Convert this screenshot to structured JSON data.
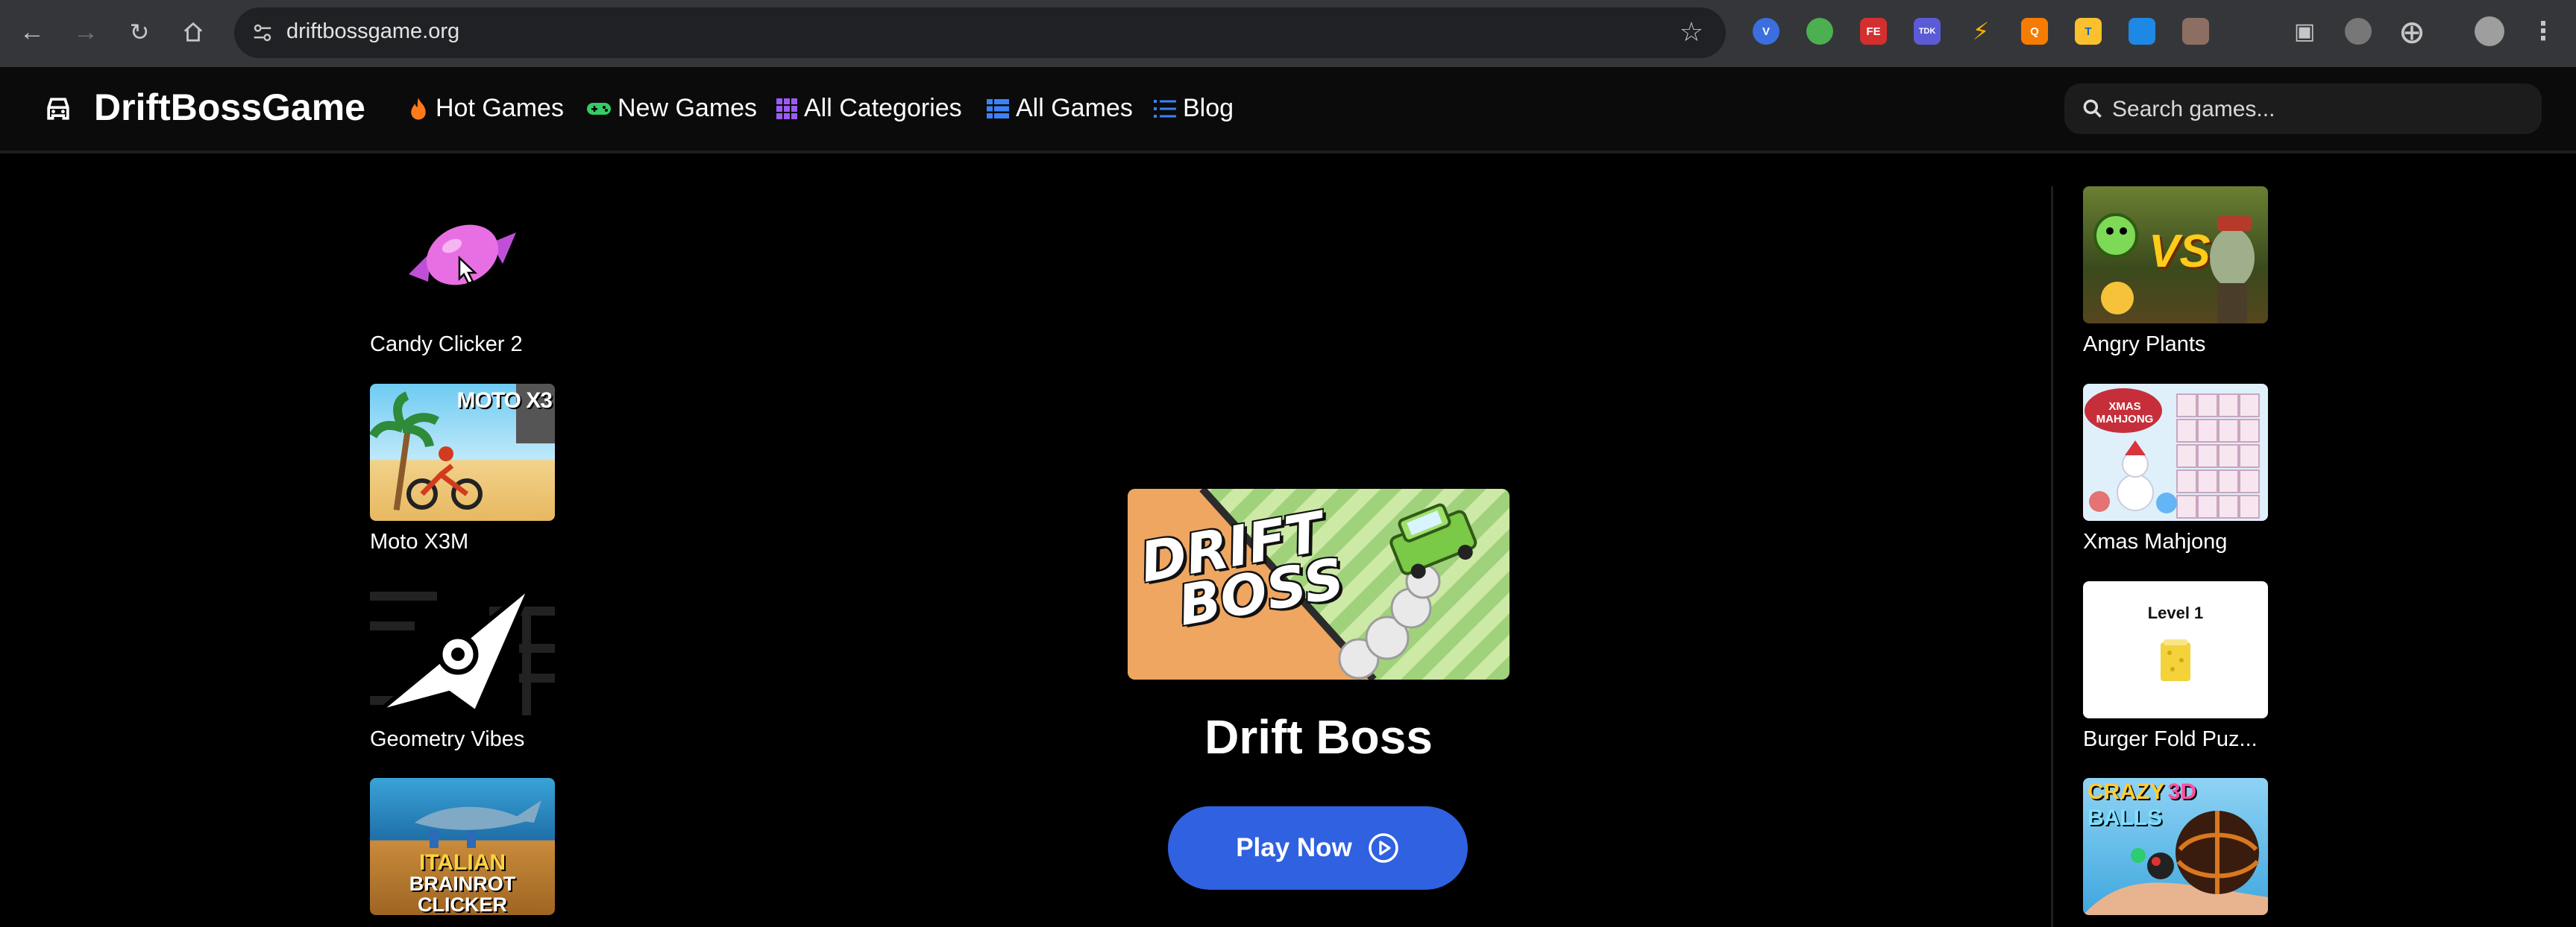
{
  "browser": {
    "url": "driftbossgame.org"
  },
  "header": {
    "logo_text": "DriftBossGame",
    "nav": [
      {
        "label": "Hot Games",
        "icon": "fire-icon",
        "color": "#ff7a1a"
      },
      {
        "label": "New Games",
        "icon": "gamepad-icon",
        "color": "#33cc66"
      },
      {
        "label": "All Categories",
        "icon": "grid-icon",
        "color": "#9b5cf6"
      },
      {
        "label": "All Games",
        "icon": "table-list-icon",
        "color": "#3b82f6"
      },
      {
        "label": "Blog",
        "icon": "list-icon",
        "color": "#3b82f6"
      }
    ],
    "search_placeholder": "Search games..."
  },
  "left_sidebar": [
    {
      "title": "Candy Clicker 2"
    },
    {
      "title": "Moto X3M"
    },
    {
      "title": "Geometry Vibes"
    },
    {
      "title": ""
    }
  ],
  "right_sidebar": [
    {
      "title": "Angry Plants"
    },
    {
      "title": "Xmas Mahjong"
    },
    {
      "title": "Burger Fold Puz..."
    },
    {
      "title": ""
    }
  ],
  "thumb_text": {
    "moto": "MOTO X3",
    "plants_vs": "VS",
    "xmas_badge": "XMAS MAHJONG",
    "burger_level": "Level 1",
    "balls_crazy": "CRAZY",
    "balls_3d": "3D",
    "balls_balls": "BALLS",
    "brainrot_1": "ITALIAN",
    "brainrot_2": "BRAINROT",
    "brainrot_3": "CLICKER",
    "hero_drift": "DRIFT",
    "hero_boss": "BOSS"
  },
  "main": {
    "game_title": "Drift Boss",
    "play_label": "Play Now"
  },
  "colors": {
    "accent": "#2f61e0",
    "page_bg": "#000000"
  }
}
